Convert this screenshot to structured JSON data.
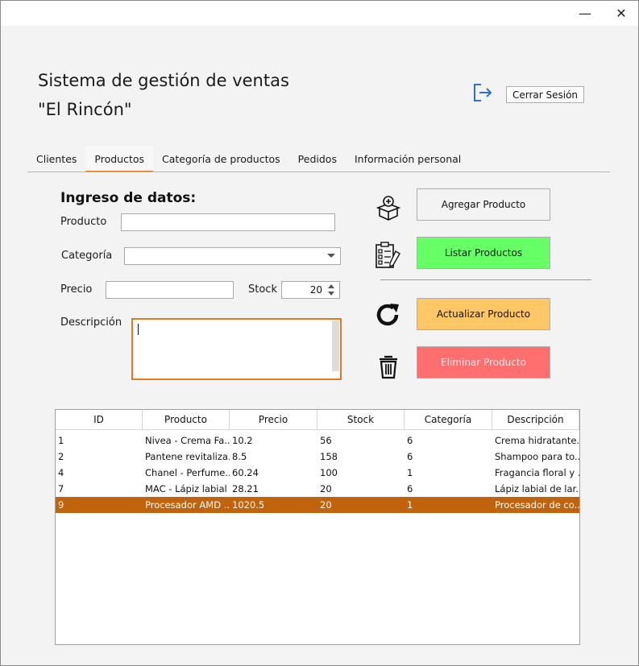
{
  "window": {
    "minimize_glyph": "—",
    "close_glyph": "✕"
  },
  "header": {
    "title_line1": "Sistema de gestión de ventas",
    "title_line2": "\"El Rincón\"",
    "logout_icon": "logout-icon",
    "logout_label": "Cerrar Sesión"
  },
  "tabs": [
    {
      "label": "Clientes",
      "active": false
    },
    {
      "label": "Productos",
      "active": true
    },
    {
      "label": "Categoría de productos",
      "active": false
    },
    {
      "label": "Pedidos",
      "active": false
    },
    {
      "label": "Información personal",
      "active": false
    }
  ],
  "form": {
    "section_title": "Ingreso de datos:",
    "producto_label": "Producto",
    "producto_value": "",
    "categoria_label": "Categoría",
    "categoria_value": "",
    "precio_label": "Precio",
    "precio_value": "",
    "stock_label": "Stock",
    "stock_value": "20",
    "descripcion_label": "Descripción",
    "descripcion_value": ""
  },
  "actions": {
    "add_label": "Agregar Producto",
    "list_label": "Listar Productos",
    "update_label": "Actualizar Producto",
    "delete_label": "Eliminar Producto",
    "colors": {
      "add": "#fdfdfd",
      "list": "#66ff66",
      "update": "#ffc766",
      "delete": "#ff6f6f"
    }
  },
  "table": {
    "columns": [
      "ID",
      "Producto",
      "Precio",
      "Stock",
      "Categoría",
      "Descripción"
    ],
    "rows": [
      {
        "cells": [
          "1",
          "Nivea - Crema Fa...",
          "10.2",
          "56",
          "6",
          "Crema hidratante..."
        ],
        "selected": false
      },
      {
        "cells": [
          "2",
          "Pantene revitaliza...",
          "8.5",
          "158",
          "6",
          "Shampoo para to..."
        ],
        "selected": false
      },
      {
        "cells": [
          "4",
          "Chanel - Perfume...",
          "60.24",
          "100",
          "1",
          "Fragancia floral y ..."
        ],
        "selected": false
      },
      {
        "cells": [
          "7",
          "MAC - Lápiz labial",
          "28.21",
          "20",
          "6",
          "Lápiz labial de lar..."
        ],
        "selected": false
      },
      {
        "cells": [
          "9",
          "Procesador AMD ...",
          "1020.5",
          "20",
          "1",
          "Procesador de co..."
        ],
        "selected": true
      }
    ],
    "selection_color": "#c0630c"
  }
}
